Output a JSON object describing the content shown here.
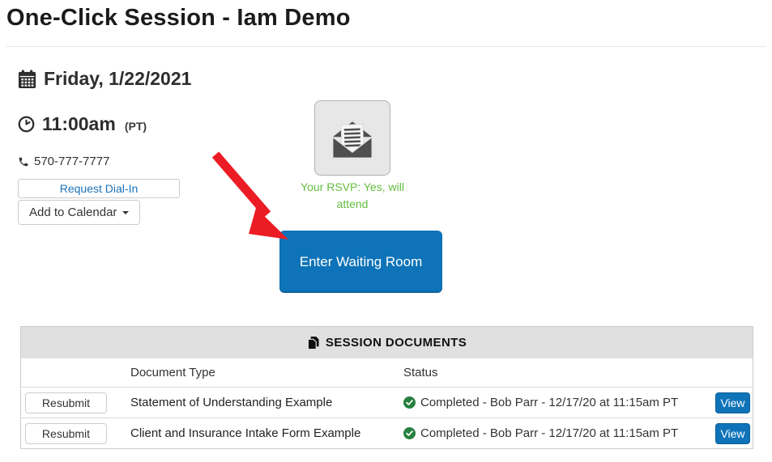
{
  "page": {
    "title": "One-Click Session - Iam Demo"
  },
  "session": {
    "date": "Friday, 1/22/2021",
    "time": "11:00am",
    "timezone": "(PT)",
    "phone": "570-777-7777",
    "request_dialin_label": "Request Dial-In",
    "add_to_calendar_label": "Add to Calendar",
    "rsvp_text": "Your RSVP: Yes, will attend",
    "enter_waiting_room_label": "Enter Waiting Room"
  },
  "documents": {
    "header": "SESSION DOCUMENTS",
    "columns": {
      "document_type": "Document Type",
      "status": "Status"
    },
    "rows": [
      {
        "action": "Resubmit",
        "type": "Statement of Understanding Example",
        "status": "Completed - Bob Parr - 12/17/20 at 11:15am PT",
        "view": "View"
      },
      {
        "action": "Resubmit",
        "type": "Client and Insurance Intake Form Example",
        "status": "Completed - Bob Parr - 12/17/20 at 11:15am PT",
        "view": "View"
      }
    ]
  },
  "colors": {
    "accent_blue": "#0e73b8",
    "link_blue": "#1b72b8",
    "rsvp_green": "#64bd3f",
    "check_green": "#26803f",
    "arrow_red": "#ec1c24",
    "header_gray": "#e0e0e0"
  }
}
